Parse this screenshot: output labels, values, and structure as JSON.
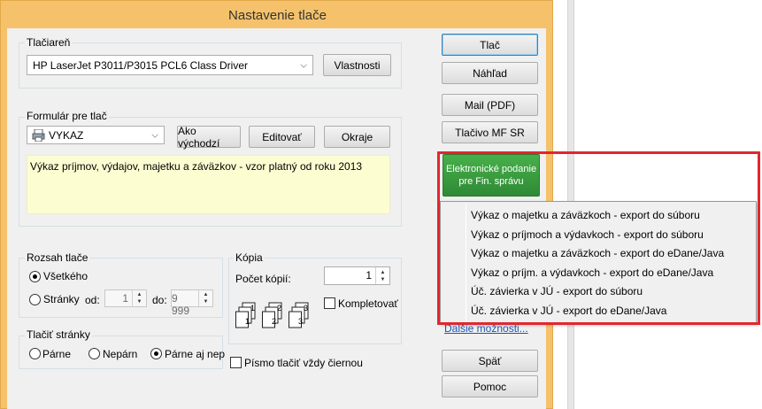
{
  "dialog": {
    "title": "Nastavenie tlače"
  },
  "printer": {
    "group_label": "Tlačiareň",
    "selected": "HP LaserJet P3011/P3015 PCL6 Class Driver",
    "properties_label": "Vlastnosti"
  },
  "form": {
    "group_label": "Formulár pre tlač",
    "selected": "VYKAZ",
    "default_label": "Ako východzí",
    "edit_label": "Editovať",
    "margins_label": "Okraje",
    "description": "Výkaz príjmov, výdajov, majetku a záväzkov - vzor platný od roku 2013"
  },
  "range": {
    "group_label": "Rozsah tlače",
    "all_label": "Všetkého",
    "pages_label": "Stránky",
    "from_label": "od:",
    "from_value": "1",
    "to_label": "do:",
    "to_value": "9 999"
  },
  "copies": {
    "group_label": "Kópia",
    "count_label": "Počet kópií:",
    "count_value": "1",
    "collate_label": "Kompletovať"
  },
  "print_pages": {
    "group_label": "Tlačiť stránky",
    "even_label": "Párne",
    "odd_label": "Nepárn",
    "both_label": "Párne aj nep"
  },
  "black_font_label": "Písmo tlačiť vždy čiernou",
  "buttons": {
    "print": "Tlač",
    "preview": "Náhľad",
    "mail": "Mail (PDF)",
    "mf_form": "Tlačivo MF SR",
    "e_submit_line1": "Elektronické podanie",
    "e_submit_line2": "pre Fin. správu",
    "more": "Ďalšie možnosti...",
    "back": "Späť",
    "help": "Pomoc"
  },
  "menu": {
    "items": [
      "Výkaz o majetku a záväzkoch - export do súboru",
      "Výkaz o príjmoch a výdavkoch - export do súboru",
      "Výkaz o majetku a záväzkoch - export do eDane/Java",
      "Výkaz o príjm. a výdavkoch - export do eDane/Java",
      "Úč. závierka v JÚ - export do súboru",
      "Úč. závierka v JÚ - export do eDane/Java"
    ]
  },
  "colors": {
    "accent_green": "#3a9a3e",
    "highlight_frame": "#e3262e",
    "title_bar": "#f5c26b",
    "description_bg": "#fdfdd2"
  }
}
